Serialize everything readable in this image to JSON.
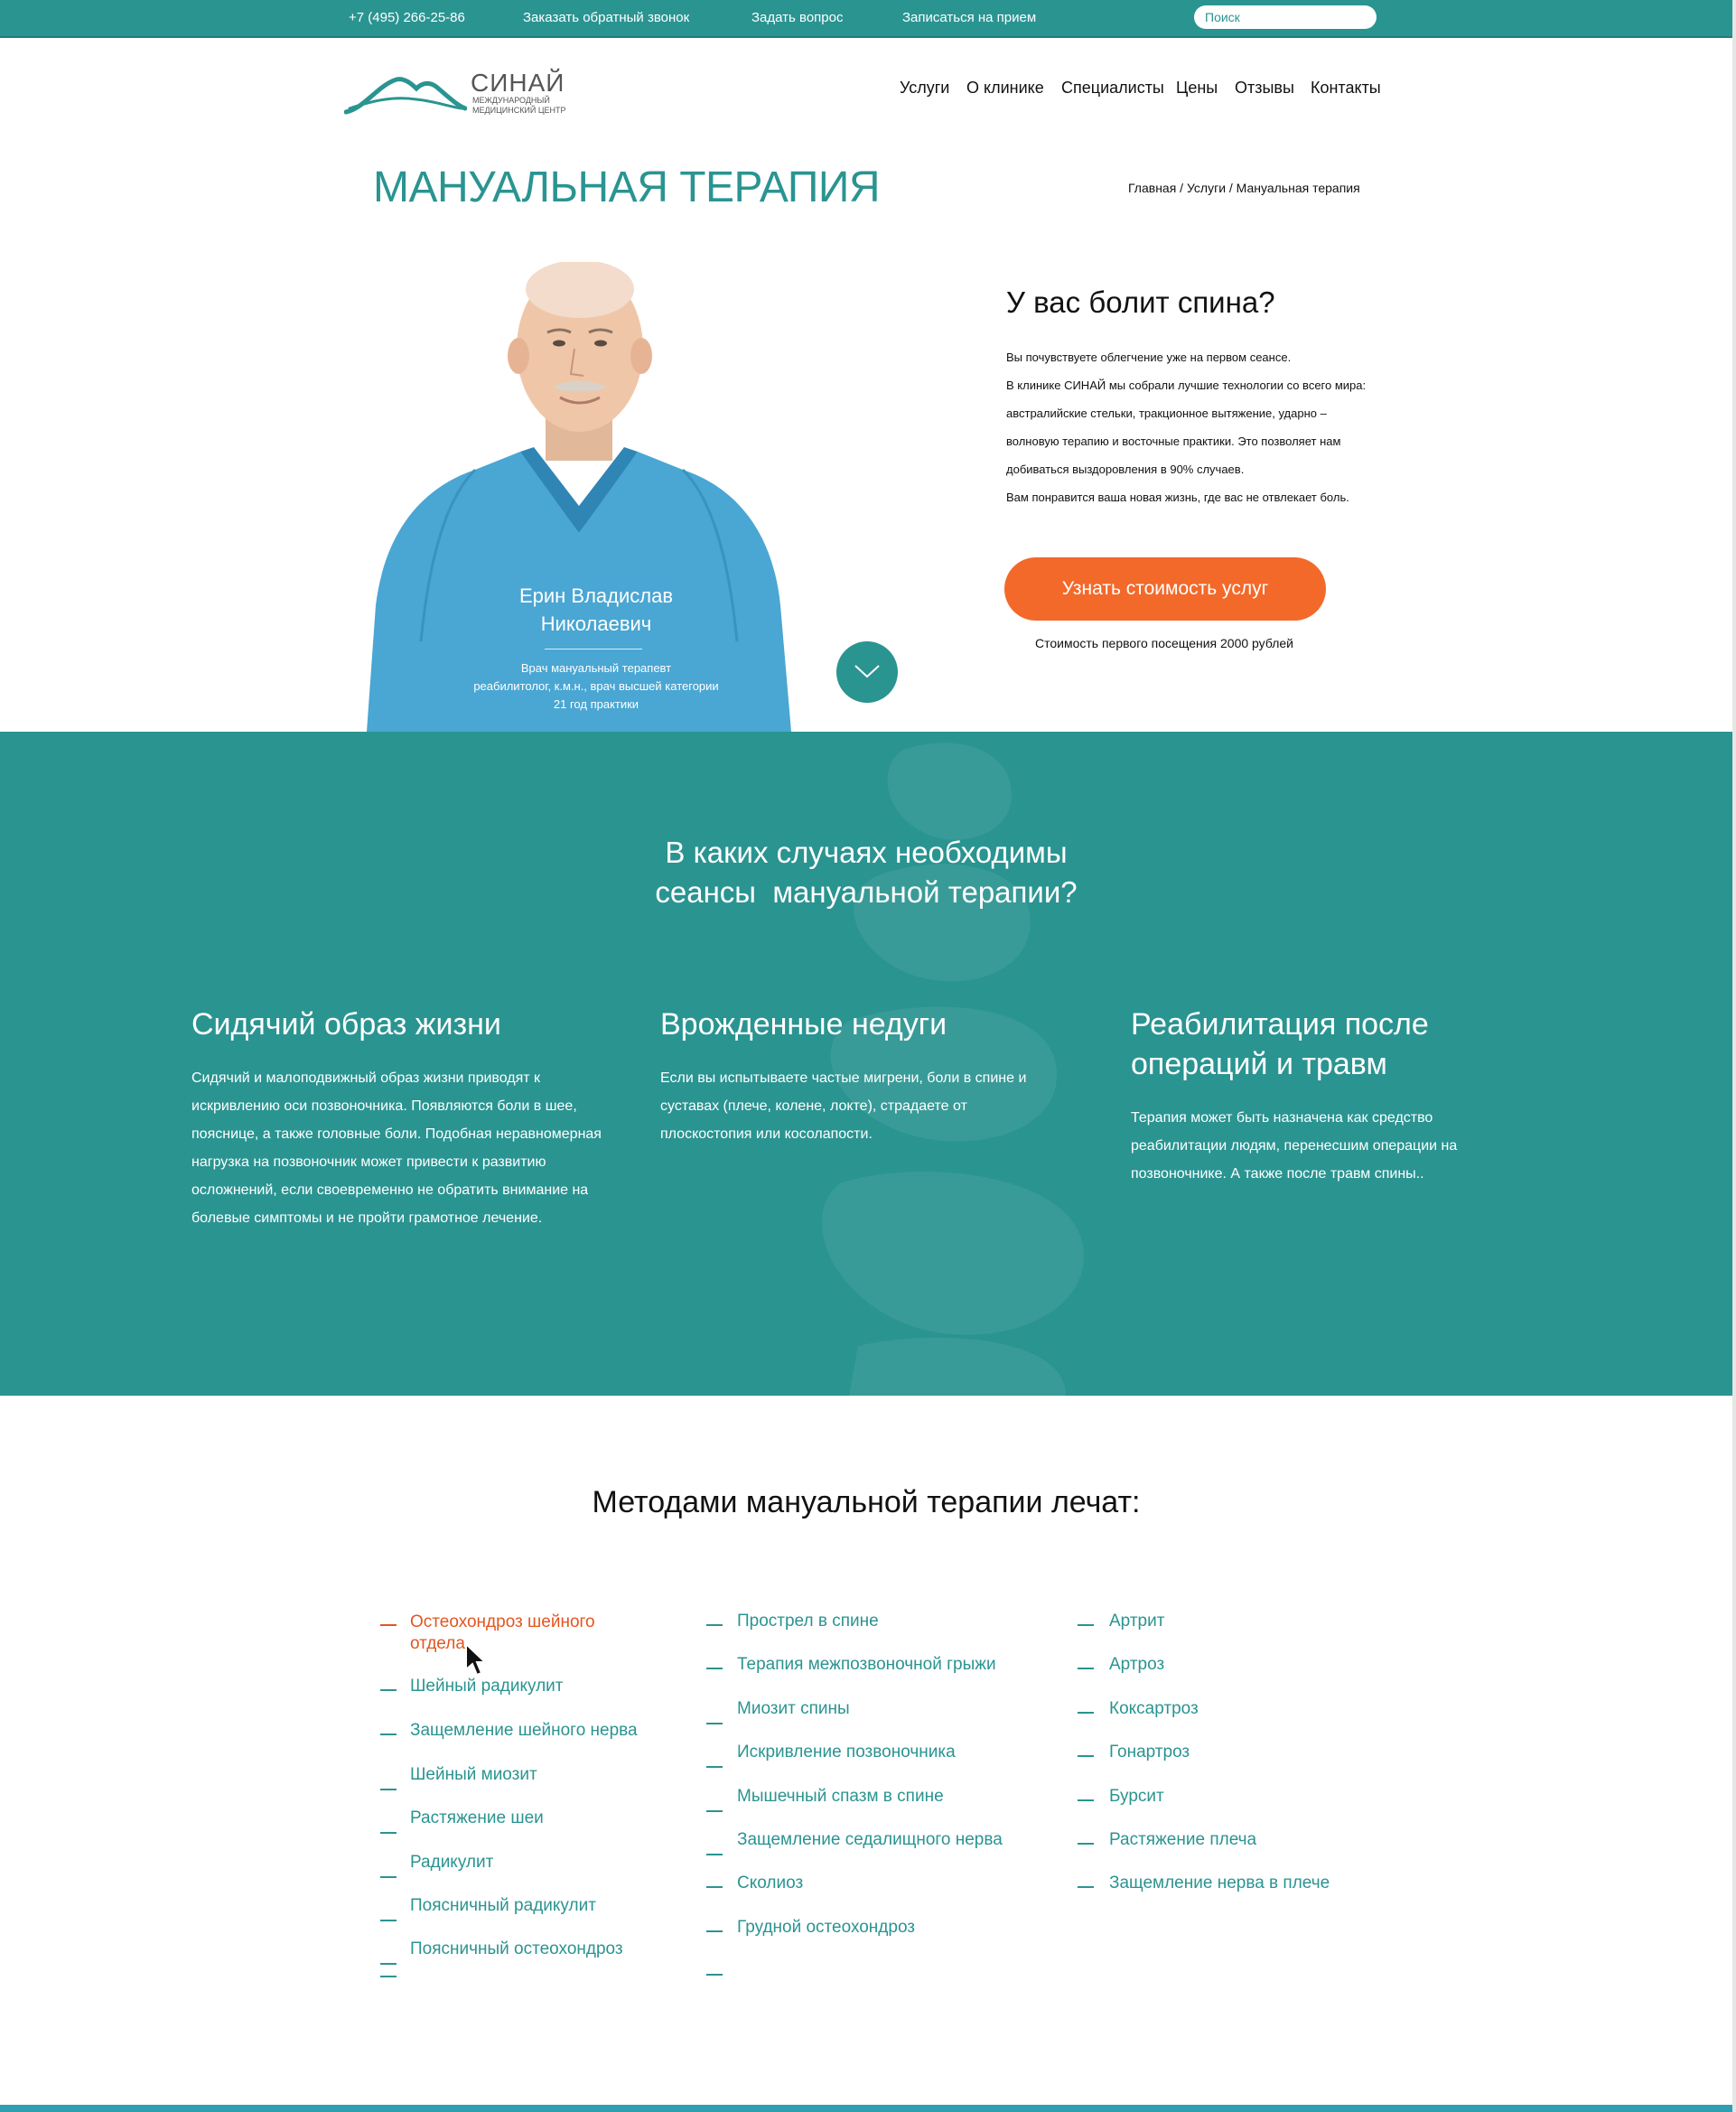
{
  "topbar": {
    "phone": "+7 (495) 266-25-86",
    "callback": "Заказать обратный звонок",
    "question": "Задать вопрос",
    "appointment": "Записаться на прием",
    "search_placeholder": "Поиск"
  },
  "logo": {
    "name": "СИНАЙ",
    "subtitle_line1": "МЕЖДУНАРОДНЫЙ",
    "subtitle_line2": "МЕДИЦИНСКИЙ ЦЕНТР"
  },
  "nav": [
    "Услуги",
    "О клинике",
    "Специалисты",
    "Цены",
    "Отзывы",
    "Контакты"
  ],
  "page": {
    "title": "МАНУАЛЬНАЯ ТЕРАПИЯ",
    "breadcrumb": "Главная / Услуги / Мануальная терапия"
  },
  "doctor": {
    "name_line1": "Ерин Владислав",
    "name_line2": "Николаевич",
    "role_line1": "Врач мануальный терапевт",
    "role_line2": "реабилитолог, к.м.н., врач высшей категории",
    "role_line3": "21 год практики"
  },
  "hero": {
    "heading": "У вас болит спина?",
    "lines": [
      "Вы почувствуете облегчение уже на первом сеансе.",
      "В клинике СИНАЙ мы собрали лучшие технологии со всего мира:",
      "австралийские стельки, тракционное вытяжение, ударно –",
      "волновую терапию и восточные практики. Это позволяет нам",
      "добиваться выздоровления в 90% случаев.",
      "Вам понравится ваша новая жизнь, где вас не отвлекает боль."
    ],
    "cta": "Узнать стоимость услуг",
    "price_note": "Стоимость первого посещения 2000 рублей"
  },
  "cases": {
    "title_line1": "В каких случаях необходимы",
    "title_line2": "сеансы  мануальной терапии?",
    "items": [
      {
        "title_line1": "Сидячий образ жизни",
        "title_line2": "",
        "text": "Сидячий и малоподвижный образ жизни приводят к искривлению оси позвоночника. Появляются боли в шее, пояснице, а также головные боли. Подобная неравномерная нагрузка на позвоночник может привести к развитию осложнений, если своевременно не обратить внимание на болевые симптомы и не пройти грамотное лечение."
      },
      {
        "title_line1": "Врожденные недуги",
        "title_line2": "",
        "text": "Если вы испытываете частые мигрени, боли в спине и суставах (плече, колене, локте), страдаете от плоскостопия или косолапости."
      },
      {
        "title_line1": "Реабилитация после",
        "title_line2": "операций и травм",
        "text": "Терапия может быть назначена как средство реабилитации людям, перенесшим операции на позвоночнике. А также после травм спины.."
      }
    ]
  },
  "methods": {
    "title": "Методами мануальной терапии лечат:",
    "col1": [
      "Остеохондроз шейного отдела",
      "Шейный радикулит",
      "Защемление шейного нерва",
      "Шейный миозит",
      "Растяжение шеи",
      "Радикулит",
      "Поясничный радикулит",
      "Поясничный остеохондроз"
    ],
    "col2": [
      "Прострел в спине",
      "Терапия межпозвоночной грыжи",
      "Миозит спины",
      "Искривление позвоночника",
      "Мышечный спазм в спине",
      "Защемление седалищного нерва",
      "Сколиоз",
      "Грудной остеохондроз"
    ],
    "col3": [
      "Артрит",
      "Артроз",
      "Коксартроз",
      "Гонартроз",
      "Бурсит",
      "Растяжение плеча",
      "Защемление нерва в плече"
    ]
  },
  "colors": {
    "brand_teal": "#2a9491",
    "accent_orange": "#f3692a",
    "hover_orange": "#e4551f"
  }
}
